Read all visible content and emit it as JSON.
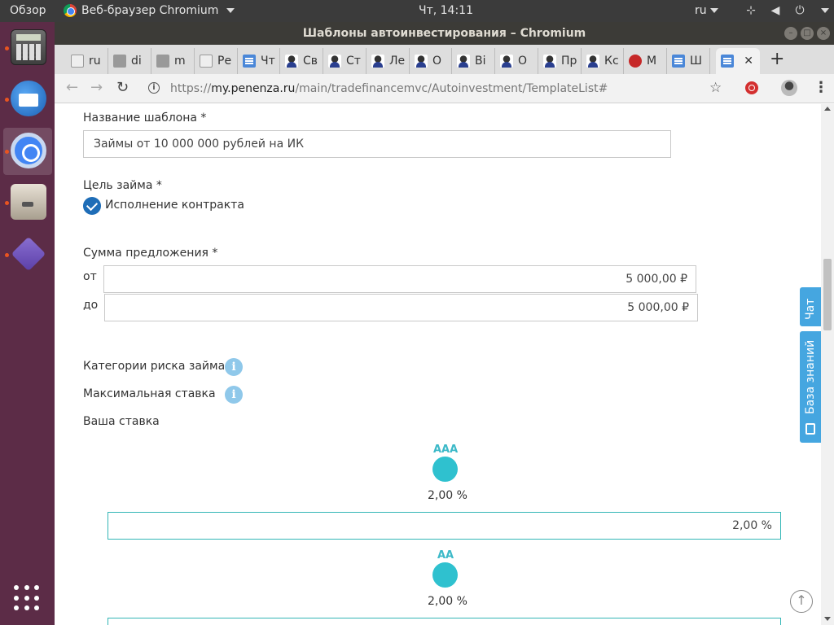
{
  "topbar": {
    "overview": "Обзор",
    "app_name": "Веб-браузер Chromium",
    "clock": "Чт, 14:11",
    "lang": "ru"
  },
  "dock": {
    "items": [
      "calculator-icon",
      "thunderbird-icon",
      "chromium-icon",
      "files-icon",
      "visual-studio-icon"
    ]
  },
  "window": {
    "title": "Шаблоны автоинвестирования – Chromium"
  },
  "tabs": [
    {
      "label": "ru",
      "icon": "page-icon"
    },
    {
      "label": "di",
      "icon": "image-icon"
    },
    {
      "label": "m",
      "icon": "image-icon"
    },
    {
      "label": "Ре",
      "icon": "page-icon"
    },
    {
      "label": "Чт",
      "icon": "doc-icon"
    },
    {
      "label": "Св",
      "icon": "user-icon"
    },
    {
      "label": "Ст",
      "icon": "user-icon"
    },
    {
      "label": "Ле",
      "icon": "user-icon"
    },
    {
      "label": "О",
      "icon": "user-icon"
    },
    {
      "label": "Ві",
      "icon": "user-icon"
    },
    {
      "label": "О",
      "icon": "user-icon"
    },
    {
      "label": "Пр",
      "icon": "user-icon"
    },
    {
      "label": "Кс",
      "icon": "user-icon"
    },
    {
      "label": "М",
      "icon": "red-icon"
    },
    {
      "label": "Ш",
      "icon": "doc-icon"
    },
    {
      "label": "",
      "icon": "doc-icon",
      "active": true
    }
  ],
  "address": {
    "scheme": "https://",
    "host": "my.penenza.ru",
    "path": "/main/tradefinancemvc/Autoinvestment/TemplateList#"
  },
  "form": {
    "template_name_label": "Название шаблона *",
    "template_name_value": "Займы от 10 000 000 рублей на ИК",
    "purpose_label": "Цель займа *",
    "purpose_option": "Исполнение контракта",
    "sum_label": "Сумма предложения *",
    "from_label": "от",
    "from_value": "5 000,00 ₽",
    "to_label": "до",
    "to_value": "5 000,00 ₽",
    "risk_label": "Категории риска займа *",
    "max_rate_label": "Максимальная ставка",
    "your_rate_label": "Ваша ставка",
    "ratings": [
      {
        "name": "AAA",
        "rate": "2,00 %",
        "input": "2,00 %"
      },
      {
        "name": "AA",
        "rate": "2,00 %",
        "input": ""
      }
    ]
  },
  "side": {
    "chat": "Чат",
    "kb": "База знаний"
  },
  "colors": {
    "accent": "#2fc1cf",
    "checkbox": "#1e6db7",
    "side_tab": "#45a6e0"
  }
}
